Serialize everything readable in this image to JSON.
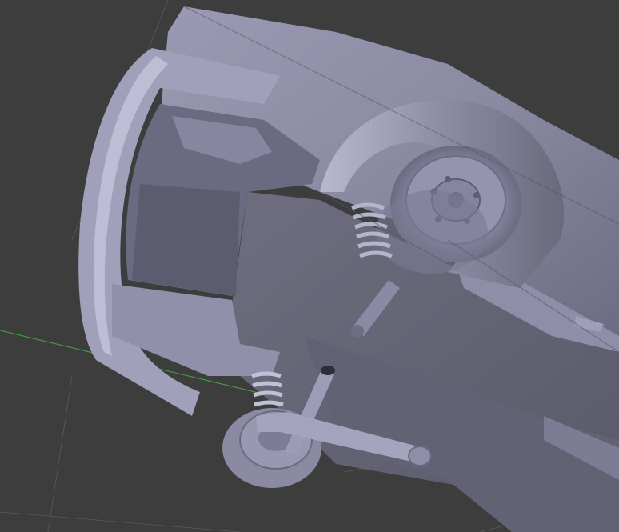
{
  "viewport": {
    "background": "#3d3d3d",
    "grid_color": "#555555",
    "x_axis_color": "#3f9a3f",
    "model_color": "#8f8fa8",
    "model_highlight": "#c3c3dc",
    "model_shadow": "#5e5e72",
    "object_name": "car-body-underside"
  }
}
